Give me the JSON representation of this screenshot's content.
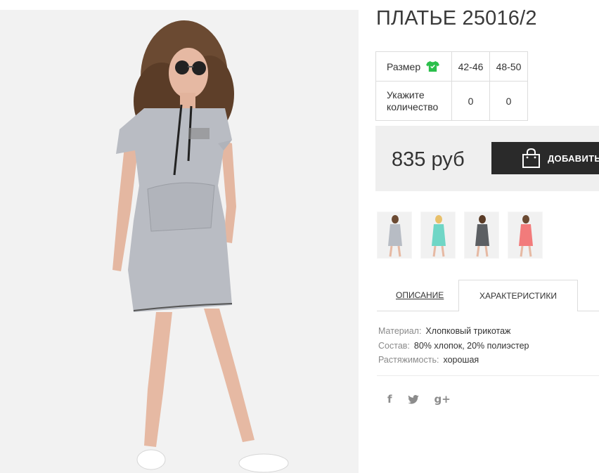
{
  "product": {
    "title": "ПЛАТЬЕ 25016/2",
    "price": "835 руб",
    "add_button_label": "ДОБАВИТЬ",
    "main_image_icon": "product-photo"
  },
  "size_table": {
    "size_label": "Размер",
    "size_icon": "tshirt-icon",
    "quantity_label": "Укажите количество",
    "sizes": [
      "42-46",
      "48-50"
    ],
    "quantities": [
      "0",
      "0"
    ]
  },
  "thumbnails": [
    {
      "color": "#b7bcc4"
    },
    {
      "color": "#6fd6c6"
    },
    {
      "color": "#5c5f63"
    },
    {
      "color": "#f27b7b"
    }
  ],
  "tabs": {
    "description": "ОПИСАНИЕ",
    "characteristics": "ХАРАКТЕРИСТИКИ"
  },
  "specs": [
    {
      "key": "Материал:",
      "value": "Хлопковый трикотаж"
    },
    {
      "key": "Состав:",
      "value": "80% хлопок, 20% полиэстер"
    },
    {
      "key": "Растяжимость:",
      "value": "хорошая"
    }
  ],
  "social": {
    "facebook": "f",
    "twitter": "twitter-icon",
    "googleplus": "g+"
  },
  "colors": {
    "accent_green": "#2bbf4b",
    "button_dark": "#2a2a2a",
    "price_bg": "#efefef"
  }
}
